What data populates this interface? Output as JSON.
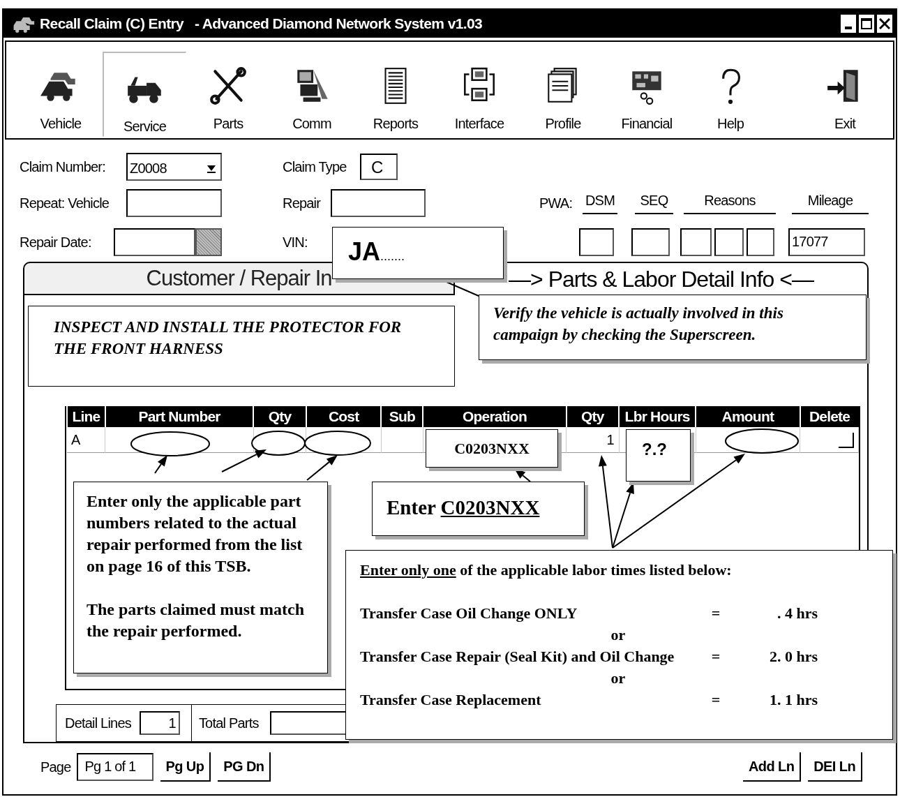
{
  "window": {
    "title": "Recall Claim (C) Entry   - Advanced Diamond Network System v1.03"
  },
  "toolbar": [
    {
      "label": "Vehicle",
      "selected": false
    },
    {
      "label": "Service",
      "selected": true
    },
    {
      "label": "Parts",
      "selected": false
    },
    {
      "label": "Comm",
      "selected": false
    },
    {
      "label": "Reports",
      "selected": false
    },
    {
      "label": "Interface",
      "selected": false
    },
    {
      "label": "Profile",
      "selected": false
    },
    {
      "label": "Financial",
      "selected": false
    },
    {
      "label": "Help",
      "selected": false
    },
    {
      "label": "Exit",
      "selected": false
    }
  ],
  "form": {
    "claim_number": {
      "label": "Claim Number:",
      "value": "Z0008"
    },
    "claim_type": {
      "label": "Claim Type",
      "value": "C"
    },
    "repeat_vehicle": {
      "label": "Repeat: Vehicle"
    },
    "repair": {
      "label": "Repair"
    },
    "repair_date": {
      "label": "Repair Date:"
    },
    "vin": {
      "label": "VIN:"
    },
    "pwa": {
      "label": "PWA:",
      "dsm": "DSM",
      "seq": "SEQ",
      "reasons": "Reasons",
      "mileage": "Mileage",
      "mileage_value": "17077"
    }
  },
  "tabs": [
    {
      "label": "Customer / Repair In",
      "selected": false
    },
    {
      "label": "—> Parts & Labor Detail Info <—",
      "selected": true
    }
  ],
  "description": "INSPECT AND INSTALL THE PROTECTOR FOR THE FRONT HARNESS",
  "grid": {
    "columns": [
      "Line",
      "Part Number",
      "Qty",
      "Cost",
      "Sub",
      "Operation",
      "Qty",
      "Lbr Hours",
      "Amount",
      "Delete"
    ],
    "rows": [
      {
        "line": "A",
        "operation_qty": "1",
        "delete": false
      }
    ]
  },
  "totals": {
    "detail_lines_label": "Detail Lines",
    "detail_lines": "1",
    "total_parts_label": "Total Parts"
  },
  "pager": {
    "label": "Page",
    "value": "Pg 1 of 1",
    "buttons": [
      "Pg Up",
      "PG Dn"
    ]
  },
  "line_buttons": [
    "Add Ln",
    "DEI Ln"
  ],
  "callouts": {
    "vin": "**JA**.......",
    "verify": "Verify the vehicle is actually involved in this campaign by checking the Superscreen.",
    "operation": "C0203NXX",
    "labor_hours": "?.?",
    "enter_operation": {
      "prefix": "Enter",
      "code": "C0203NXX"
    },
    "parts_note": [
      "Enter only the applicable part numbers related to the actual repair performed from the list on page 16 of this TSB.",
      "The parts claimed must match the repair performed."
    ],
    "labor": {
      "heading_underlined": "Enter only one",
      "heading_rest": "of the applicable labor times listed below:",
      "lines": [
        {
          "kind": "option",
          "label": "Transfer Case Oil Change ONLY",
          "equals": "=",
          "hours": ". 4 hrs"
        },
        {
          "kind": "separator",
          "text": "or"
        },
        {
          "kind": "option",
          "label": "Transfer Case Repair (Seal Kit) and Oil Change",
          "equals": "=",
          "hours": "2. 0 hrs"
        },
        {
          "kind": "separator",
          "text": "or"
        },
        {
          "kind": "option",
          "label": "Transfer Case Replacement",
          "equals": "=",
          "hours": "1. 1 hrs"
        }
      ]
    }
  }
}
